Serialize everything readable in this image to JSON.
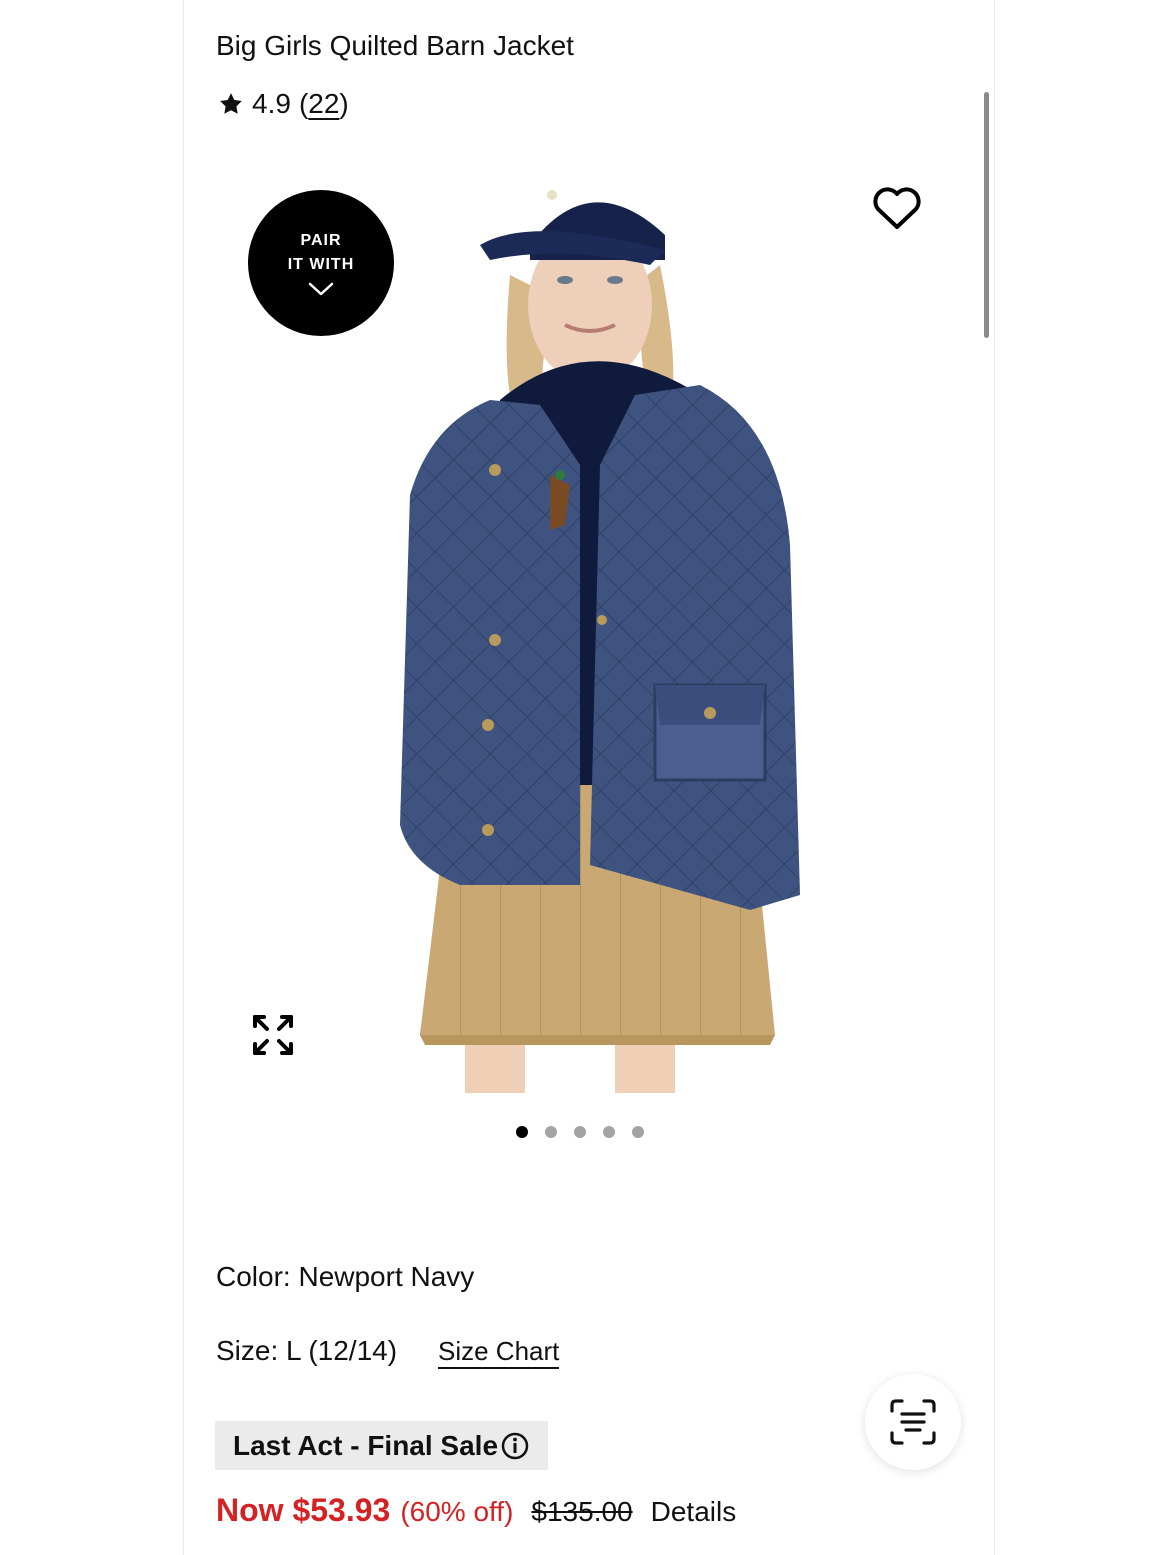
{
  "product": {
    "title": "Big Girls Quilted Barn Jacket",
    "rating": "4.9",
    "review_count_open": "(",
    "review_count": "22",
    "review_count_close": ")"
  },
  "pair_badge": {
    "line1": "PAIR",
    "line2": "IT WITH"
  },
  "gallery": {
    "image_count": 5,
    "active_index": 0
  },
  "selection": {
    "color_label": "Color: Newport Navy",
    "size_label": "Size: L (12/14)",
    "size_chart_link": "Size Chart"
  },
  "promo": {
    "tag": "Last Act - Final Sale"
  },
  "pricing": {
    "now_price": "Now $53.93",
    "percent_off": "(60% off)",
    "original_price": "$135.00",
    "details_link": "Details"
  },
  "colors": {
    "sale_red": "#d42124",
    "tag_bg": "#ebebeb",
    "jacket_navy": "#3b4f78",
    "skirt_khaki": "#c9a874"
  },
  "icons": [
    "star-icon",
    "heart-icon",
    "chevron-down-icon",
    "expand-icon",
    "info-icon",
    "scan-icon"
  ]
}
